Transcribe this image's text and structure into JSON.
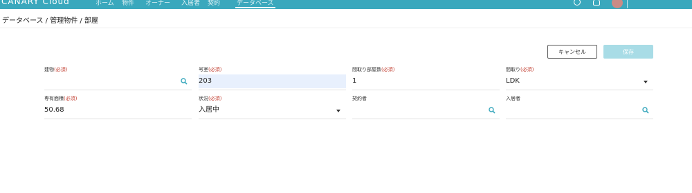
{
  "header": {
    "logo": "CANARY Cloud",
    "nav_items": [
      "ホーム",
      "物件",
      "オーナー",
      "入居者",
      "契約",
      "データベース"
    ]
  },
  "breadcrumb": "データベース / 管理物件 / 部屋",
  "buttons": {
    "cancel": "キャンセル",
    "save": "保存"
  },
  "form": {
    "building": {
      "label": "建物",
      "required": "(必須)",
      "value": ""
    },
    "room_no": {
      "label": "号室",
      "required": "(必須)",
      "value": "203"
    },
    "room_count": {
      "label": "間取り部屋数",
      "required": "(必須)",
      "value": "1"
    },
    "layout": {
      "label": "間取り",
      "required": "(必須)",
      "value": "LDK"
    },
    "area": {
      "label": "専有面積",
      "required": "(必須)",
      "value": "50.68"
    },
    "status": {
      "label": "状況",
      "required": "(必須)",
      "value": "入居中"
    },
    "contractor": {
      "label": "契約者",
      "value": ""
    },
    "tenant": {
      "label": "入居者",
      "value": ""
    }
  },
  "colors": {
    "header_bg": "#3aa8bd",
    "required": "#c0392b",
    "save_disabled": "#a8dce6",
    "highlight": "#e8f0fd"
  }
}
